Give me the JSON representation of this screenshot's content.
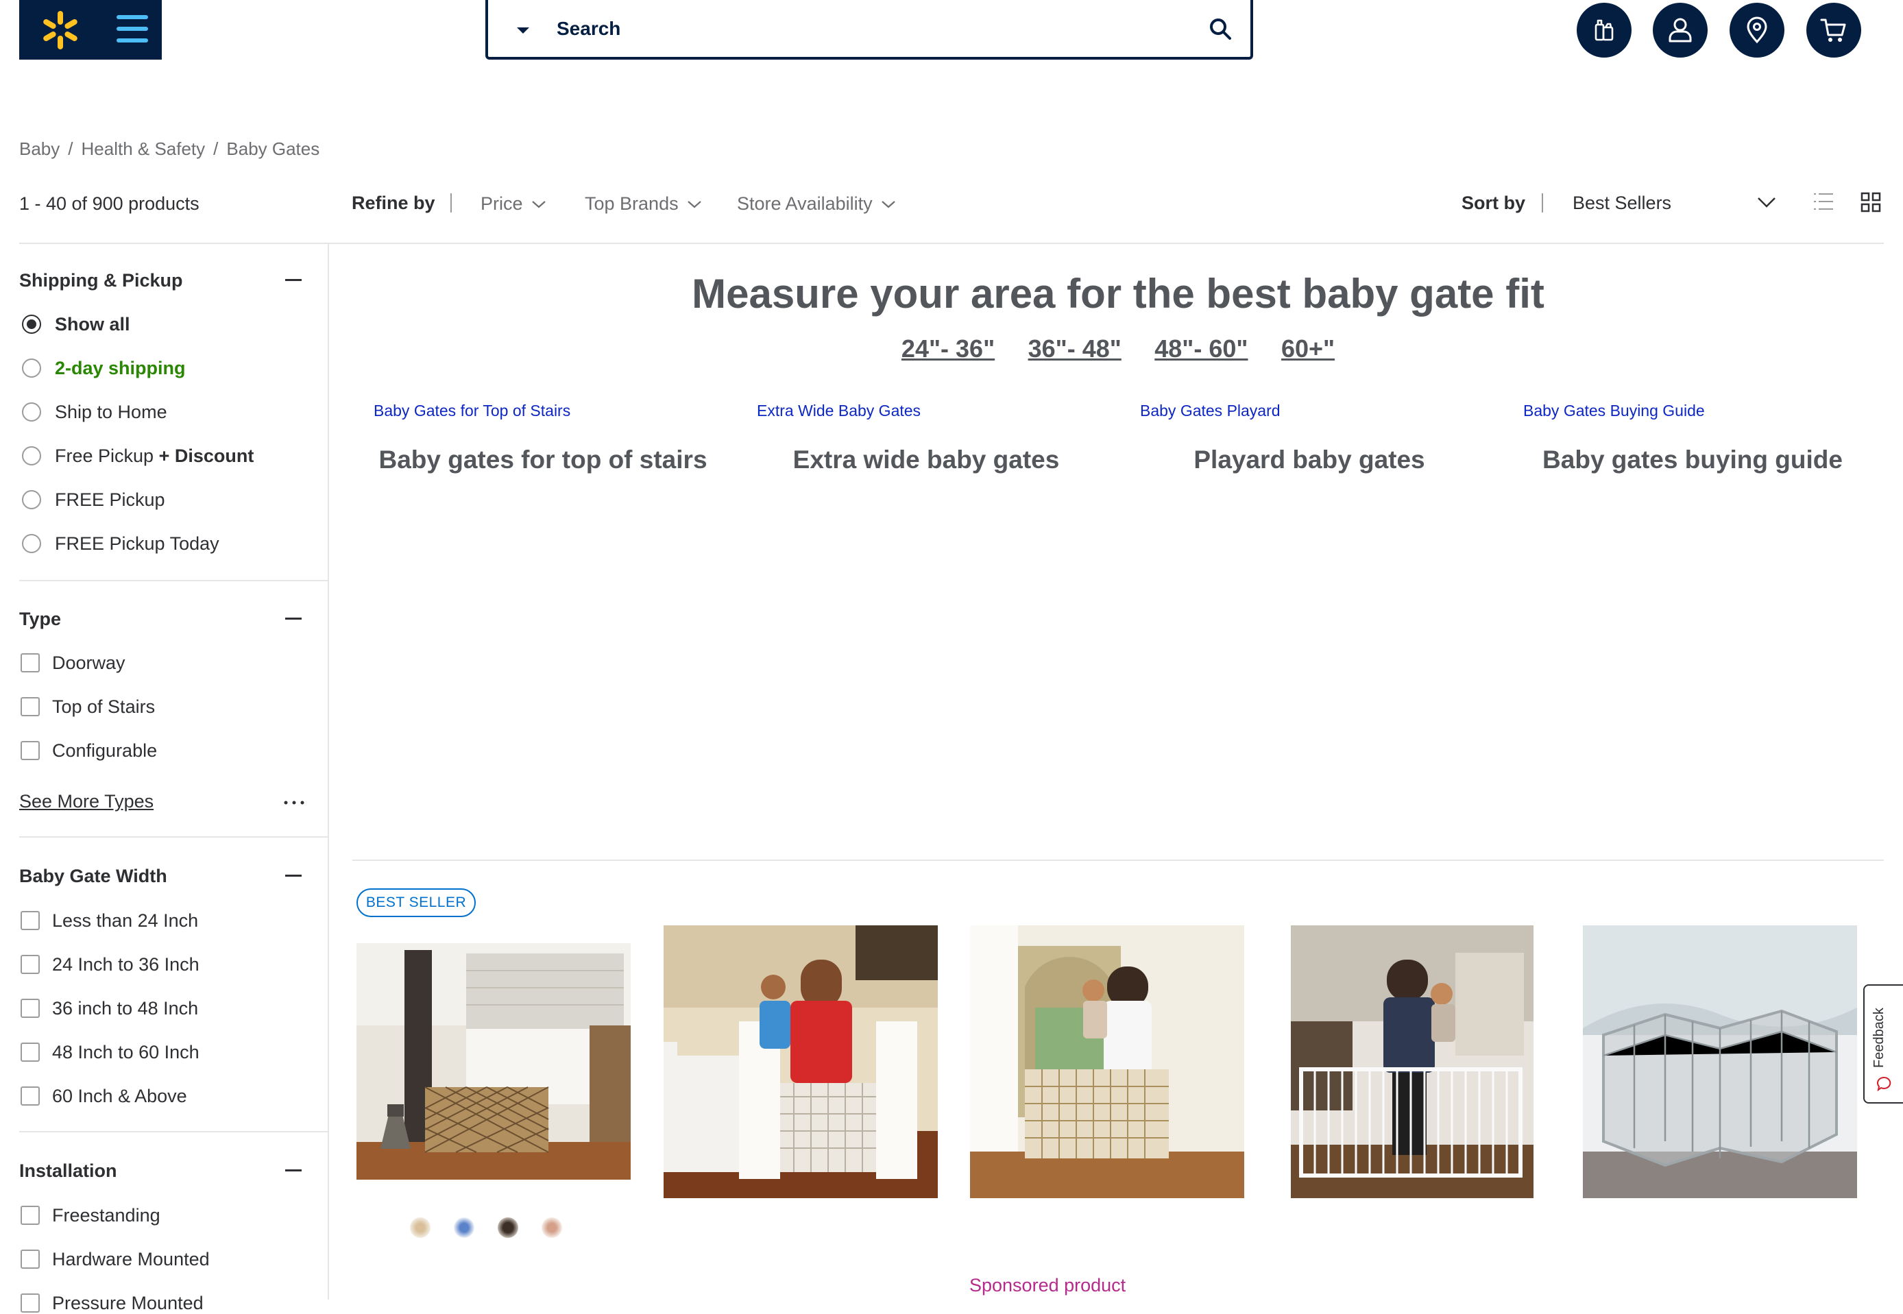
{
  "header": {
    "search_placeholder": "Search",
    "icons": [
      "spark-logo-icon",
      "menu-icon",
      "search-icon",
      "reorder-icon",
      "account-icon",
      "location-icon",
      "cart-icon"
    ],
    "brand_colors": {
      "navy": "#041e42",
      "yellow": "#ffc220",
      "blue": "#4dbdf5"
    }
  },
  "breadcrumb": [
    "Baby",
    "Health & Safety",
    "Baby Gates"
  ],
  "breadcrumb_sep": "/",
  "toolbar": {
    "count": "1 - 40 of 900 products",
    "refine_label": "Refine by",
    "filters": [
      "Price",
      "Top Brands",
      "Store Availability"
    ],
    "sort_label": "Sort by",
    "sort_value": "Best Sellers"
  },
  "sidebar": {
    "shipping": {
      "title": "Shipping & Pickup",
      "options": [
        {
          "label": "Show all",
          "checked": true
        },
        {
          "label": "2-day shipping",
          "checked": false
        },
        {
          "label": "Ship to Home",
          "checked": false
        },
        {
          "label": "Free Pickup",
          "suffix": "+ Discount",
          "checked": false
        },
        {
          "label": "FREE Pickup",
          "checked": false
        },
        {
          "label": "FREE Pickup Today",
          "checked": false
        }
      ]
    },
    "type": {
      "title": "Type",
      "options": [
        "Doorway",
        "Top of Stairs",
        "Configurable"
      ],
      "see_more": "See More Types"
    },
    "width": {
      "title": "Baby Gate Width",
      "options": [
        "Less than 24 Inch",
        "24 Inch to 36 Inch",
        "36 inch to 48 Inch",
        "48 Inch to 60 Inch",
        "60 Inch & Above"
      ]
    },
    "installation": {
      "title": "Installation",
      "options": [
        "Freestanding",
        "Hardware Mounted",
        "Pressure Mounted"
      ]
    }
  },
  "main": {
    "hero_title": "Measure your area for the best baby gate fit",
    "measure_links": [
      "24\"- 36\"",
      "36\"- 48\"",
      "48\"- 60\"",
      "60+\""
    ],
    "categories": [
      {
        "link": "Baby Gates for Top of Stairs",
        "title": "Baby gates for top of stairs"
      },
      {
        "link": "Extra Wide Baby Gates",
        "title": "Extra wide baby gates"
      },
      {
        "link": "Baby Gates Playard",
        "title": "Playard baby gates"
      },
      {
        "link": "Baby Gates Buying Guide",
        "title": "Baby gates buying guide"
      }
    ],
    "badge": "BEST SELLER",
    "sponsored": "Sponsored product",
    "feedback": "Feedback"
  }
}
